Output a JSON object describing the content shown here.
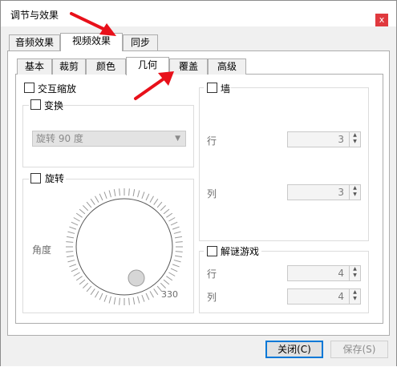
{
  "window": {
    "title": "调节与效果",
    "close_label": "x"
  },
  "tabs": [
    {
      "label": "音频效果",
      "active": false
    },
    {
      "label": "视频效果",
      "active": true
    },
    {
      "label": "同步",
      "active": false
    }
  ],
  "subtabs": [
    {
      "label": "基本",
      "active": false
    },
    {
      "label": "裁剪",
      "active": false
    },
    {
      "label": "颜色",
      "active": false
    },
    {
      "label": "几何",
      "active": true
    },
    {
      "label": "覆盖",
      "active": false
    },
    {
      "label": "高级",
      "active": false
    }
  ],
  "geometry": {
    "interactive_zoom_label": "交互缩放",
    "interactive_zoom_checked": false,
    "transform": {
      "label": "变换",
      "checked": false,
      "select_value": "旋转 90 度"
    },
    "rotate": {
      "label": "旋转",
      "checked": false,
      "angle_label": "角度",
      "dial_value_label": "330"
    },
    "wall": {
      "label": "墙",
      "checked": false,
      "rows_label": "行",
      "rows_value": "3",
      "cols_label": "列",
      "cols_value": "3"
    },
    "puzzle": {
      "label": "解谜游戏",
      "checked": false,
      "rows_label": "行",
      "rows_value": "4",
      "cols_label": "列",
      "cols_value": "4"
    }
  },
  "buttons": {
    "close_label": "关闭(C)",
    "save_label": "保存(S)"
  },
  "colors": {
    "annotation_arrow": "#e8101a",
    "close_button": "#e0393e",
    "default_button_border": "#0078d7"
  }
}
